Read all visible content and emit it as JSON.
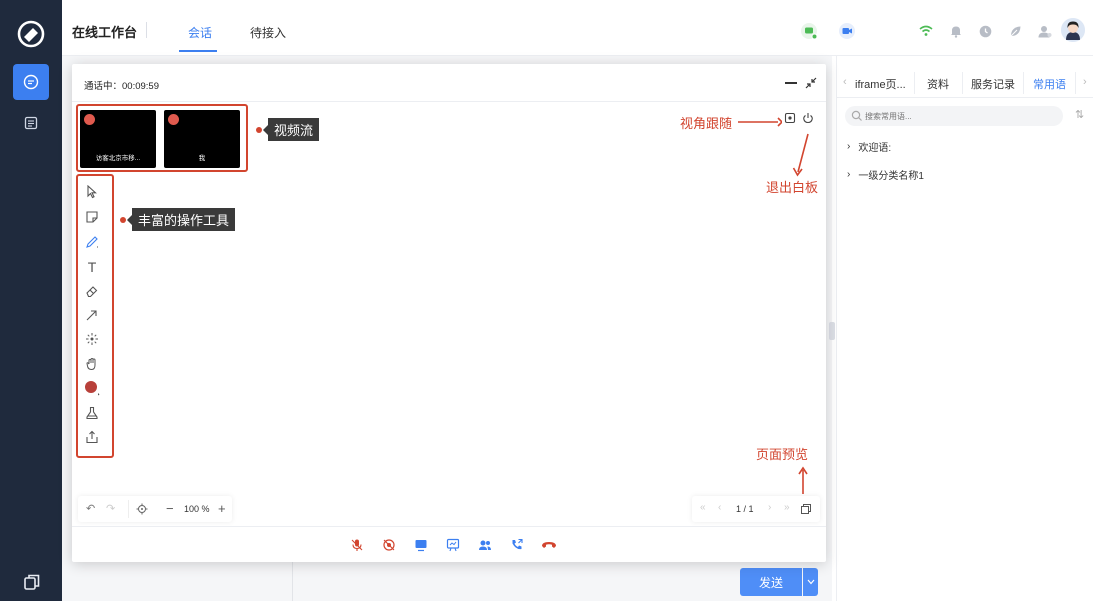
{
  "header": {
    "app_title": "在线工作台",
    "tabs": [
      {
        "label": "会话",
        "active": true
      },
      {
        "label": "待接入",
        "active": false
      }
    ]
  },
  "colors": {
    "accent": "#3c7ff0",
    "rail": "#1f2a3d",
    "annotation": "#d2452f",
    "online": "#4cbb55"
  },
  "call": {
    "status": "通话中：00:09:59",
    "videos": [
      {
        "name": "访客北京市移..."
      },
      {
        "name": "我"
      }
    ]
  },
  "annotations": {
    "video_stream": "视频流",
    "tools": "丰富的操作工具",
    "view_follow": "视角跟随",
    "exit_whiteboard": "退出白板",
    "page_preview": "页面预览"
  },
  "toolbar": {
    "tools": [
      "cursor-icon",
      "sticky-note-icon",
      "pen-icon",
      "text-icon",
      "eraser-icon",
      "arrow-icon",
      "laser-pointer-icon",
      "hand-icon",
      "color-picker-icon",
      "clear-icon",
      "upload-icon"
    ]
  },
  "zoom": {
    "level": "100 %"
  },
  "pagination": {
    "current": "1 / 1"
  },
  "composer": {
    "send_label": "发送"
  },
  "right_panel": {
    "tabs": [
      {
        "label": "iframe页...",
        "active": false
      },
      {
        "label": "资料",
        "active": false
      },
      {
        "label": "服务记录",
        "active": false
      },
      {
        "label": "常用语",
        "active": true
      }
    ],
    "search_placeholder": "搜索常用语...",
    "groups": [
      "欢迎语:",
      "一级分类名称1"
    ]
  }
}
